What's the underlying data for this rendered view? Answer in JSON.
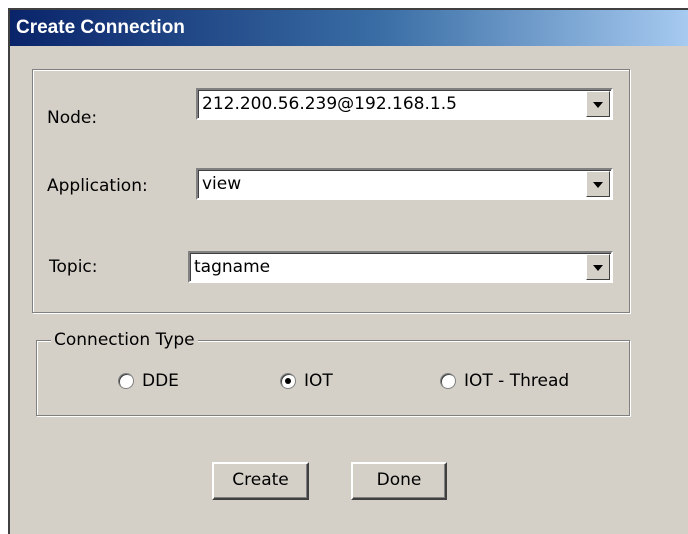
{
  "window": {
    "title": "Create Connection"
  },
  "form": {
    "node_label": "Node:",
    "node_value": "212.200.56.239@192.168.1.5",
    "application_label": "Application:",
    "application_value": "view",
    "topic_label": "Topic:",
    "topic_value": "tagname"
  },
  "connection_type": {
    "legend": "Connection Type",
    "options": [
      {
        "label": "DDE",
        "selected": false
      },
      {
        "label": "IOT",
        "selected": true
      },
      {
        "label": "IOT - Thread",
        "selected": false
      }
    ]
  },
  "buttons": {
    "create_label": "Create",
    "done_label": "Done"
  },
  "colors": {
    "dialog_bg": "#d4d0c8",
    "titlebar_start": "#0a246a",
    "titlebar_end": "#a6caf0"
  },
  "icons": {
    "dropdown": "chevron-down-icon"
  }
}
